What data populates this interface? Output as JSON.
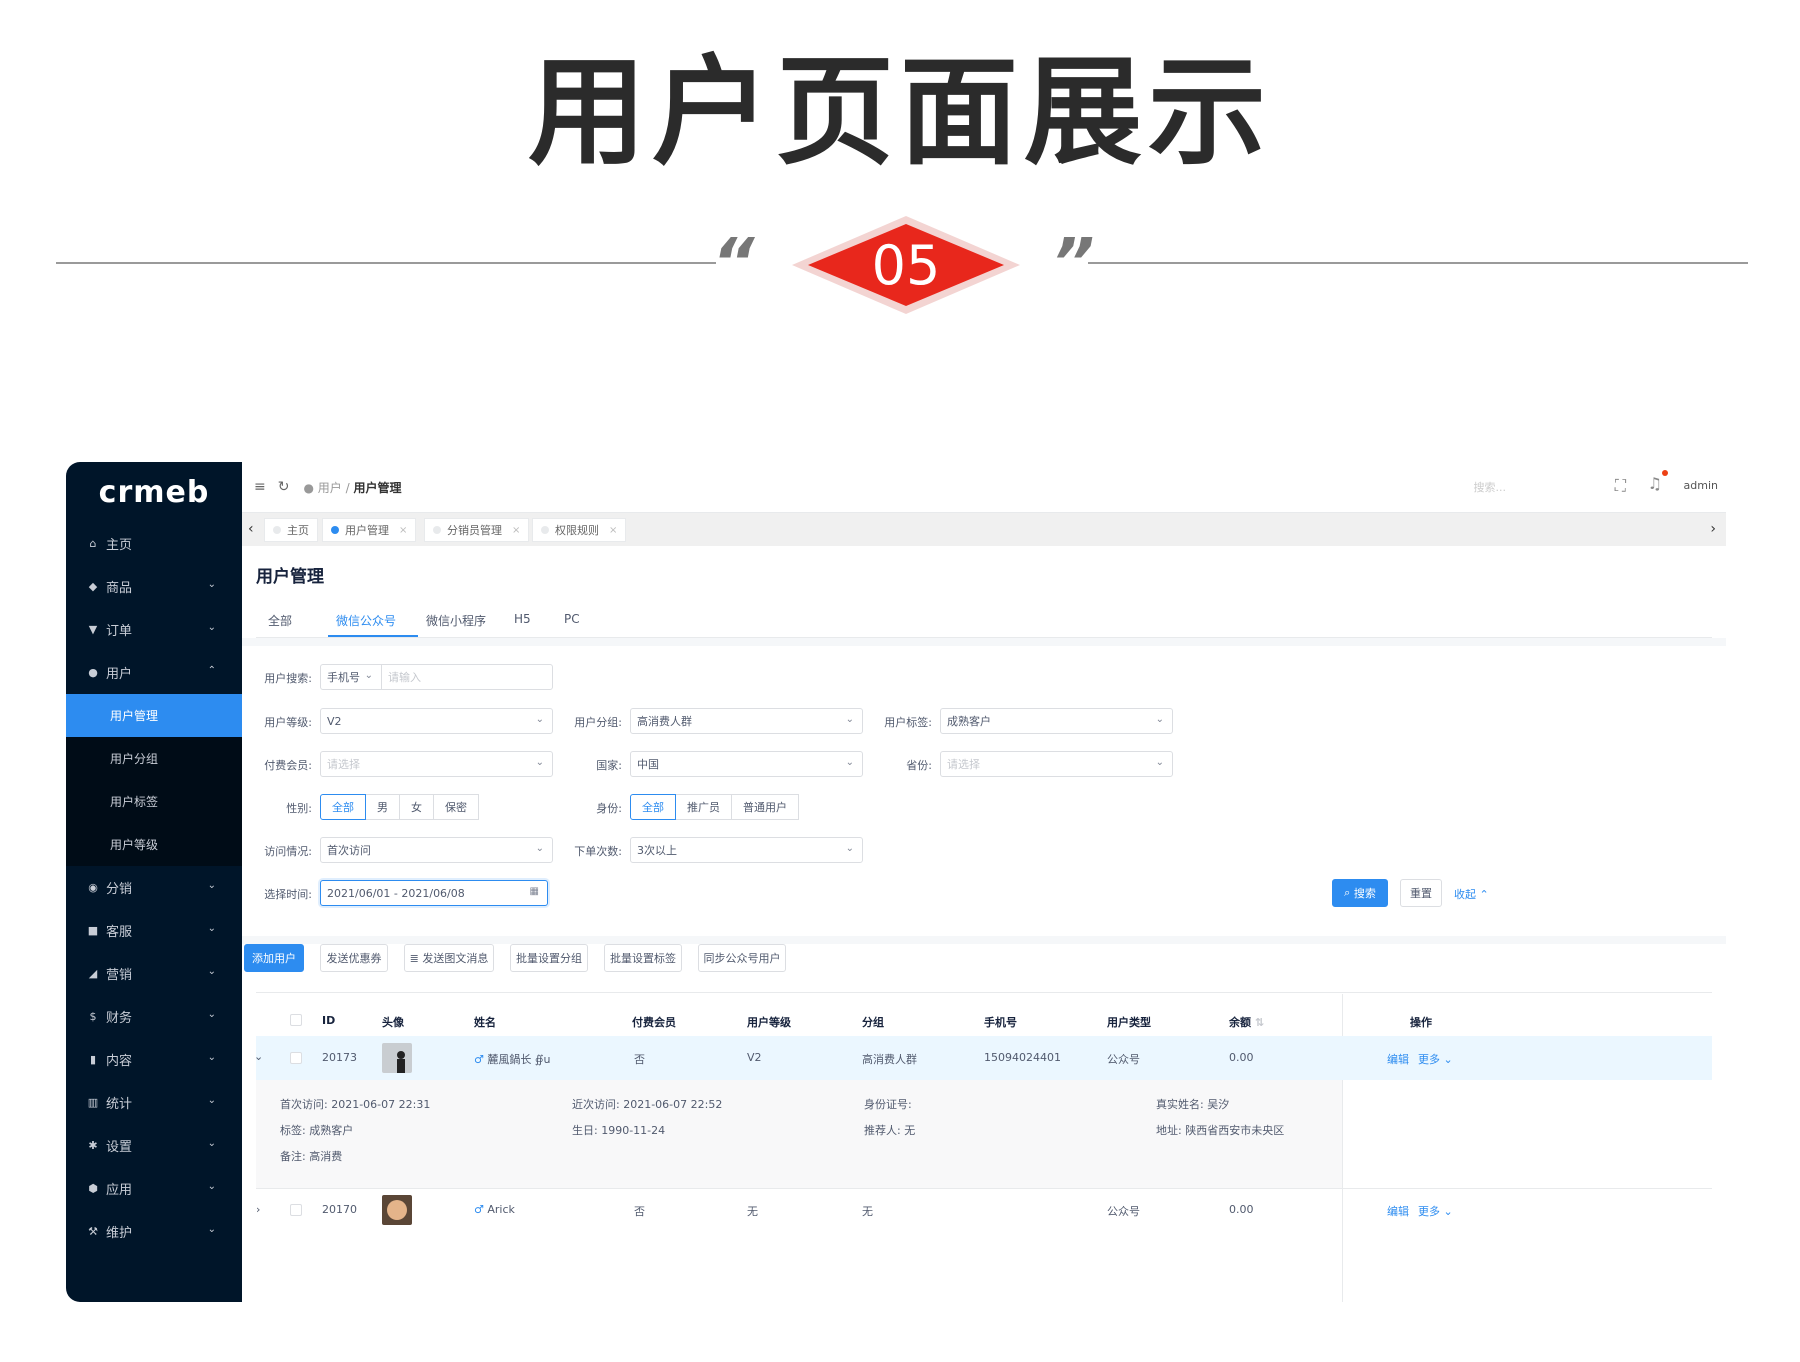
{
  "banner": {
    "title": "用户页面展示",
    "number": "05",
    "quote_left": "“",
    "quote_right": "”"
  },
  "sidebar": {
    "logo": "crmeb",
    "items": [
      {
        "icon": "home-icon",
        "glyph": "⌂",
        "label": "主页"
      },
      {
        "icon": "goods-icon",
        "glyph": "◆",
        "label": "商品"
      },
      {
        "icon": "cart-icon",
        "glyph": "▼",
        "label": "订单"
      },
      {
        "icon": "user-icon",
        "glyph": "●",
        "label": "用户"
      },
      {
        "icon": "share-icon",
        "glyph": "◉",
        "label": "分销"
      },
      {
        "icon": "chat-icon",
        "glyph": "■",
        "label": "客服"
      },
      {
        "icon": "send-icon",
        "glyph": "◢",
        "label": "营销"
      },
      {
        "icon": "dollar-icon",
        "glyph": "$",
        "label": "财务"
      },
      {
        "icon": "book-icon",
        "glyph": "▮",
        "label": "内容"
      },
      {
        "icon": "chart-icon",
        "glyph": "▥",
        "label": "统计"
      },
      {
        "icon": "gear-icon",
        "glyph": "✱",
        "label": "设置"
      },
      {
        "icon": "cube-icon",
        "glyph": "⬢",
        "label": "应用"
      },
      {
        "icon": "hammer-icon",
        "glyph": "⚒",
        "label": "维护"
      }
    ],
    "sub_items": [
      "用户管理",
      "用户分组",
      "用户标签",
      "用户等级"
    ]
  },
  "topbar": {
    "crumb_parent": "用户",
    "crumb_current": "用户管理",
    "search_placeholder": "搜索...",
    "user": "admin"
  },
  "page_tabs": [
    "主页",
    "用户管理",
    "分销员管理",
    "权限规则"
  ],
  "page": {
    "title": "用户管理",
    "tabs": [
      "全部",
      "微信公众号",
      "微信小程序",
      "H5",
      "PC"
    ]
  },
  "filters": {
    "search_label": "用户搜索:",
    "search_type": "手机号",
    "search_placeholder": "请输入",
    "level_label": "用户等级:",
    "level_value": "V2",
    "group_label": "用户分组:",
    "group_value": "高消费人群",
    "tag_label": "用户标签:",
    "tag_value": "成熟客户",
    "paid_label": "付费会员:",
    "paid_placeholder": "请选择",
    "country_label": "国家:",
    "country_value": "中国",
    "province_label": "省份:",
    "province_placeholder": "请选择",
    "gender_label": "性别:",
    "gender_options": [
      "全部",
      "男",
      "女",
      "保密"
    ],
    "identity_label": "身份:",
    "identity_options": [
      "全部",
      "推广员",
      "普通用户"
    ],
    "visit_label": "访问情况:",
    "visit_value": "首次访问",
    "orders_label": "下单次数:",
    "orders_value": "3次以上",
    "time_label": "选择时间:",
    "time_value": "2021/06/01 - 2021/06/08",
    "search_btn": "搜索",
    "reset_btn": "重置",
    "collapse_link": "收起"
  },
  "actions": [
    "添加用户",
    "发送优惠券",
    "发送图文消息",
    "批量设置分组",
    "批量设置标签",
    "同步公众号用户"
  ],
  "table": {
    "headers": [
      "ID",
      "头像",
      "姓名",
      "付费会员",
      "用户等级",
      "分组",
      "手机号",
      "用户类型",
      "余额",
      "操作"
    ],
    "rows": [
      {
        "id": "20173",
        "name": "麓風鍋长 ∯u",
        "paid": "否",
        "level": "V2",
        "group": "高消费人群",
        "phone": "15094024401",
        "type": "公众号",
        "balance": "0.00",
        "edit": "编辑",
        "more": "更多"
      },
      {
        "id": "20170",
        "name": "Arick",
        "paid": "否",
        "level": "无",
        "group": "无",
        "phone": "",
        "type": "公众号",
        "balance": "0.00",
        "edit": "编辑",
        "more": "更多"
      }
    ],
    "expand": {
      "first_visit": "首次访问:  2021-06-07 22:31",
      "last_visit": "近次访问:  2021-06-07 22:52",
      "id_card": "身份证号:",
      "real_name": "真实姓名:  吴汐",
      "tag": "标签:  成熟客户",
      "birthday": "生日:  1990-11-24",
      "referrer": "推荐人:  无",
      "address": "地址:  陕西省西安市未央区",
      "note": "备注:  高消费"
    }
  },
  "colors": {
    "accent": "#2d8cf0",
    "sidebar": "#001529",
    "badge": "#e8271c"
  }
}
